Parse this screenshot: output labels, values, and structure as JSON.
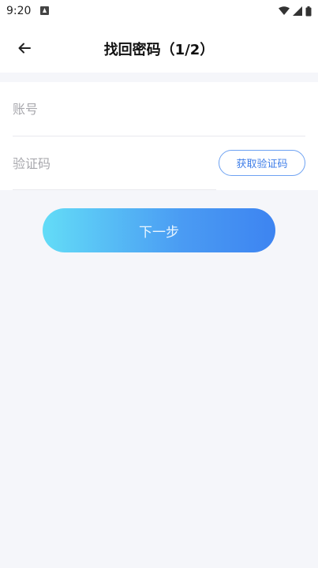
{
  "status_bar": {
    "time": "9:20",
    "icons": [
      "app-notification-icon",
      "wifi-icon",
      "cell-signal-icon",
      "battery-icon"
    ]
  },
  "header": {
    "back_icon": "arrow-left-icon",
    "title": "找回密码（1/2）"
  },
  "form": {
    "account": {
      "value": "",
      "placeholder": "账号"
    },
    "code": {
      "value": "",
      "placeholder": "验证码"
    },
    "get_code_label": "获取验证码"
  },
  "actions": {
    "next_label": "下一步"
  },
  "colors": {
    "background": "#f5f6fa",
    "accent_blue": "#3f7ee8",
    "gradient_start": "#63dcf7",
    "gradient_end": "#3d84f1"
  }
}
